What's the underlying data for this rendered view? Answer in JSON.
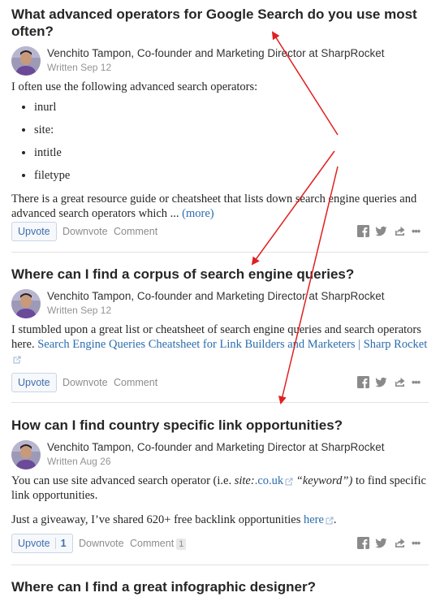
{
  "feed": {
    "q1": {
      "title": "What advanced operators for Google Search do you use most often?",
      "author": "Venchito Tampon, Co-founder and Marketing Director at SharpRocket",
      "written": "Written Sep 12",
      "intro": "I often use the following advanced search operators:",
      "bullets": [
        "inurl",
        "site:",
        "intitle",
        "filetype"
      ],
      "body": "There is a great resource guide or cheatsheet that lists down search engine queries and advanced search operators which ...",
      "more": "(more)"
    },
    "q2": {
      "title": "Where can I find a corpus of search engine queries?",
      "author": "Venchito Tampon, Co-founder and Marketing Director at SharpRocket",
      "written": "Written Sep 12",
      "body": "I stumbled upon a great list or cheatsheet of search engine queries and search operators here.",
      "link": "Search Engine Queries Cheatsheet for Link Builders and Marketers | Sharp Rocket"
    },
    "q3": {
      "title": "How can I find country specific link opportunities?",
      "author": "Venchito Tampon, Co-founder and Marketing Director at SharpRocket",
      "written": "Written Aug 26",
      "p1_a": "You can use site advanced search operator (i.e. ",
      "p1_site": "site:",
      "p1_link": ".co.uk",
      "p1_kw": "“keyword”)",
      "p1_b": " to find specific link opportunities.",
      "p2": "Just a giveaway, I’ve shared 620+ free backlink opportunities ",
      "p2_link": "here",
      "p2_end": ".",
      "upvote_count": "1",
      "comment_count": "1"
    },
    "q4": {
      "title": "Where can I find a great infographic designer?"
    }
  },
  "actions": {
    "upvote": "Upvote",
    "downvote": "Downvote",
    "comment": "Comment",
    "more": "•••"
  },
  "colors": {
    "link": "#2b6dad",
    "annotation_arrow": "#e02020",
    "upvote_text": "#3e6eb0"
  },
  "icons": [
    "facebook-icon",
    "twitter-icon",
    "share-icon",
    "more-options-icon",
    "external-link-icon"
  ]
}
